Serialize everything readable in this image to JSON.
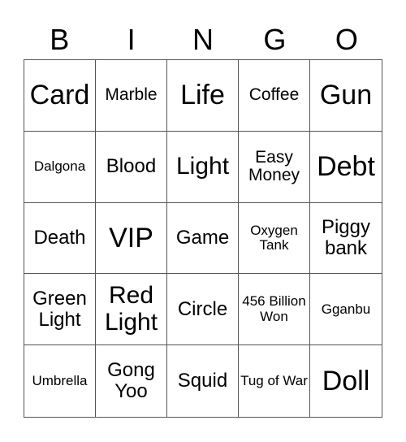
{
  "header": {
    "letters": [
      "B",
      "I",
      "N",
      "G",
      "O"
    ]
  },
  "cells": [
    {
      "text": "Card",
      "size": "s1"
    },
    {
      "text": "Marble",
      "size": "s4"
    },
    {
      "text": "Life",
      "size": "s1"
    },
    {
      "text": "Coffee",
      "size": "s4"
    },
    {
      "text": "Gun",
      "size": "s1"
    },
    {
      "text": "Dalgona",
      "size": "s5"
    },
    {
      "text": "Blood",
      "size": "s3"
    },
    {
      "text": "Light",
      "size": "s2"
    },
    {
      "text": "Easy Money",
      "size": "s4"
    },
    {
      "text": "Debt",
      "size": "s1"
    },
    {
      "text": "Death",
      "size": "s3"
    },
    {
      "text": "VIP",
      "size": "s1"
    },
    {
      "text": "Game",
      "size": "s3"
    },
    {
      "text": "Oxygen Tank",
      "size": "s5"
    },
    {
      "text": "Piggy bank",
      "size": "s3"
    },
    {
      "text": "Green Light",
      "size": "s3"
    },
    {
      "text": "Red Light",
      "size": "s2"
    },
    {
      "text": "Circle",
      "size": "s3"
    },
    {
      "text": "456 Billion Won",
      "size": "s5"
    },
    {
      "text": "Gganbu",
      "size": "s5"
    },
    {
      "text": "Umbrella",
      "size": "s5"
    },
    {
      "text": "Gong Yoo",
      "size": "s3"
    },
    {
      "text": "Squid",
      "size": "s3"
    },
    {
      "text": "Tug of War",
      "size": "s5"
    },
    {
      "text": "Doll",
      "size": "s1"
    }
  ]
}
